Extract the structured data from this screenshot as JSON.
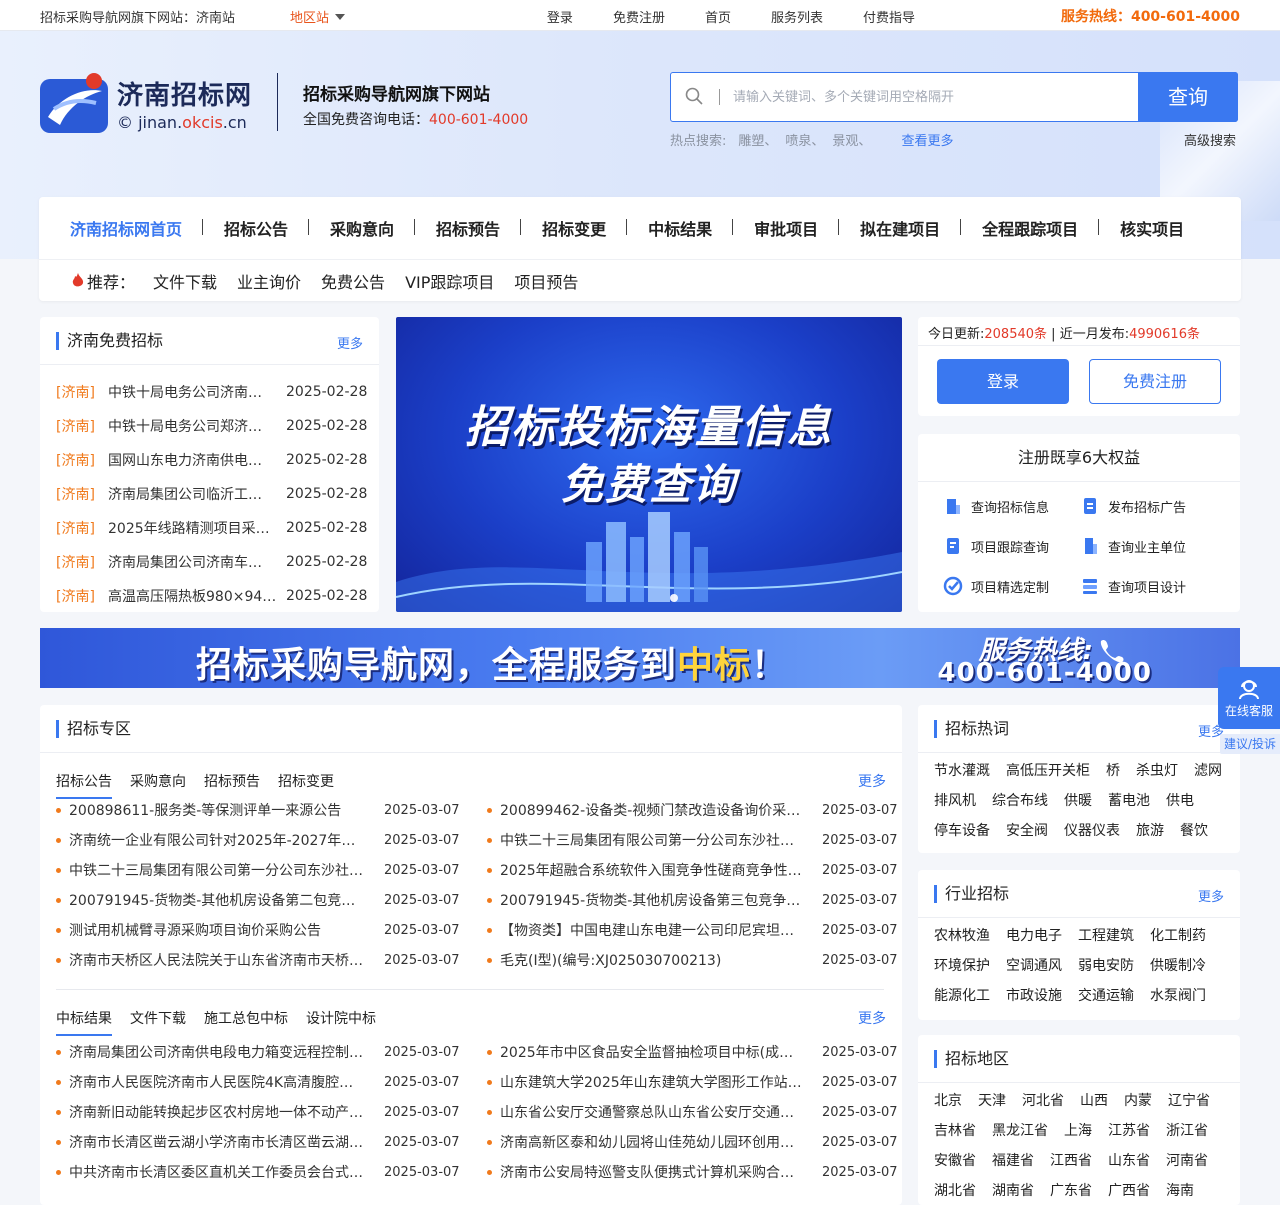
{
  "topbar": {
    "site": "招标采购导航网旗下网站：济南站",
    "region": "地区站",
    "links": [
      "登录",
      "免费注册",
      "首页",
      "服务列表",
      "付费指导"
    ],
    "hotline": "服务热线：400-601-4000"
  },
  "header": {
    "logo_name": "济南招标网",
    "logo_domain_prefix": "© jinan.",
    "logo_domain_hl": "okcis",
    "logo_domain_suffix": ".cn",
    "tagline": "招标采购导航网旗下网站",
    "consult_label": "全国免费咨询电话：",
    "consult_phone": "400-601-4000"
  },
  "search": {
    "placeholder": "请输入关键词、多个关键词用空格隔开",
    "button": "查询",
    "hot_label": "热点搜索:",
    "hot_words": [
      "雕塑、",
      "喷泉、",
      "景观、"
    ],
    "more": "查看更多",
    "advanced": "高级搜索"
  },
  "nav": {
    "main": [
      "济南招标网首页",
      "招标公告",
      "采购意向",
      "招标预告",
      "招标变更",
      "中标结果",
      "审批项目",
      "拟在建项目",
      "全程跟踪项目",
      "核实项目"
    ],
    "rec_label": "推荐：",
    "sub": [
      "文件下载",
      "业主询价",
      "免费公告",
      "VIP跟踪项目",
      "项目预告"
    ]
  },
  "free": {
    "title": "济南免费招标",
    "more": "更多",
    "items": [
      {
        "city": "[济南]",
        "title": "中铁十局电务公司济南…",
        "date": "2025-02-28"
      },
      {
        "city": "[济南]",
        "title": "中铁十局电务公司郑济…",
        "date": "2025-02-28"
      },
      {
        "city": "[济南]",
        "title": "国网山东电力济南供电…",
        "date": "2025-02-28"
      },
      {
        "city": "[济南]",
        "title": "济南局集团公司临沂工…",
        "date": "2025-02-28"
      },
      {
        "city": "[济南]",
        "title": "2025年线路精测项目采…",
        "date": "2025-02-28"
      },
      {
        "city": "[济南]",
        "title": "济南局集团公司济南车…",
        "date": "2025-02-28"
      },
      {
        "city": "[济南]",
        "title": "高温高压隔热板980×94…",
        "date": "2025-02-28"
      }
    ]
  },
  "banner": {
    "line1": "招标投标海量信息",
    "line2": "免费查询"
  },
  "stats": {
    "today_label": "今日更新:",
    "today_value": "208540条",
    "sep": " | ",
    "month_label": "近一月发布:",
    "month_value": "4990616条"
  },
  "account": {
    "login": "登录",
    "register": "免费注册"
  },
  "benefits": {
    "title": "注册既享6大权益",
    "items": [
      "查询招标信息",
      "发布招标广告",
      "项目跟踪查询",
      "查询业主单位",
      "项目精选定制",
      "查询项目设计"
    ]
  },
  "strip": {
    "text_a": "招标采购导航网，全程服务到",
    "text_b": "中标",
    "text_c": "！",
    "hotline_label": "服务热线:",
    "hotline": "400-601-4000"
  },
  "zone": {
    "title": "招标专区",
    "tabs1": [
      "招标公告",
      "采购意向",
      "招标预告",
      "招标变更"
    ],
    "more1": "更多",
    "left1": [
      {
        "t": "200898611-服务类-等保测评单一来源公告",
        "d": "2025-03-07"
      },
      {
        "t": "济南统一企业有限公司针对2025年-2027年度…",
        "d": "2025-03-07"
      },
      {
        "t": "中铁二十三局集团有限公司第一分公司东沙社…",
        "d": "2025-03-07"
      },
      {
        "t": "200791945-货物类-其他机房设备第二包竞争…",
        "d": "2025-03-07"
      },
      {
        "t": "测试用机械臂寻源采购项目询价采购公告",
        "d": "2025-03-07"
      },
      {
        "t": "济南市天桥区人民法院关于山东省济南市天桥…",
        "d": "2025-03-07"
      }
    ],
    "right1": [
      {
        "t": "200899462-设备类-视频门禁改造设备询价采…",
        "d": "2025-03-07"
      },
      {
        "t": "中铁二十三局集团有限公司第一分公司东沙社…",
        "d": "2025-03-07"
      },
      {
        "t": "2025年超融合系统软件入围竞争性磋商竞争性…",
        "d": "2025-03-07"
      },
      {
        "t": "200791945-货物类-其他机房设备第三包竞争…",
        "d": "2025-03-07"
      },
      {
        "t": "【物资类】中国电建山东电建一公司印尼宾坦…",
        "d": "2025-03-07"
      },
      {
        "t": "毛克(I型)(编号:XJ025030700213)",
        "d": "2025-03-07"
      }
    ],
    "tabs2": [
      "中标结果",
      "文件下载",
      "施工总包中标",
      "设计院中标"
    ],
    "more2": "更多",
    "left2": [
      {
        "t": "济南局集团公司济南供电段电力箱变远程控制…",
        "d": "2025-03-07"
      },
      {
        "t": "济南市人民医院济南市人民医院4K高清腹腔镜…",
        "d": "2025-03-07"
      },
      {
        "t": "济南新旧动能转换起步区农村房地一体不动产…",
        "d": "2025-03-07"
      },
      {
        "t": "济南市长清区凿云湖小学济南市长清区凿云湖…",
        "d": "2025-03-07"
      },
      {
        "t": "中共济南市长清区委区直机关工作委员会台式…",
        "d": "2025-03-07"
      }
    ],
    "right2": [
      {
        "t": "2025年市中区食品安全监督抽检项目中标(成交…",
        "d": "2025-03-07"
      },
      {
        "t": "山东建筑大学2025年山东建筑大学图形工作站…",
        "d": "2025-03-07"
      },
      {
        "t": "山东省公安厅交通警察总队山东省公安厅交通…",
        "d": "2025-03-07"
      },
      {
        "t": "济南高新区泰和幼儿园将山佳苑幼儿园环创用…",
        "d": "2025-03-07"
      },
      {
        "t": "济南市公安局特巡警支队便携式计算机采购合…",
        "d": "2025-03-07"
      }
    ]
  },
  "hotwords": {
    "title": "招标热词",
    "more": "更多",
    "items": [
      "节水灌溉",
      "高低压开关柜",
      "桥",
      "杀虫灯",
      "滤网",
      "排风机",
      "综合布线",
      "供暖",
      "蓄电池",
      "供电",
      "停车设备",
      "安全阀",
      "仪器仪表",
      "旅游",
      "餐饮"
    ]
  },
  "industry": {
    "title": "行业招标",
    "more": "更多",
    "items": [
      "农林牧渔",
      "电力电子",
      "工程建筑",
      "化工制药",
      "环境保护",
      "空调通风",
      "弱电安防",
      "供暖制冷",
      "能源化工",
      "市政设施",
      "交通运输",
      "水泵阀门"
    ]
  },
  "regions": {
    "title": "招标地区",
    "items": [
      "北京",
      "天津",
      "河北省",
      "山西",
      "内蒙",
      "辽宁省",
      "吉林省",
      "黑龙江省",
      "上海",
      "江苏省",
      "浙江省",
      "安徽省",
      "福建省",
      "江西省",
      "山东省",
      "河南省",
      "湖北省",
      "湖南省",
      "广东省",
      "广西省",
      "海南"
    ]
  },
  "float": {
    "service": "在线客服",
    "feedback": "建议/投诉"
  },
  "colors": {
    "primary": "#3a78f0",
    "accent": "#f07a1c",
    "red": "#e23a2a"
  }
}
